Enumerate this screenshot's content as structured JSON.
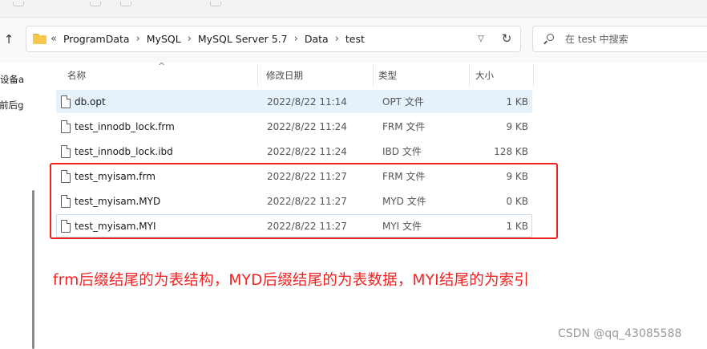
{
  "address_bar": {
    "lead": "«",
    "crumbs": [
      "ProgramData",
      "MySQL",
      "MySQL Server 5.7",
      "Data",
      "test"
    ]
  },
  "search": {
    "placeholder": "在 test 中搜索"
  },
  "sidebar": {
    "items": [
      "设备a",
      "-前后g"
    ]
  },
  "columns": {
    "name": "名称",
    "date": "修改日期",
    "type": "类型",
    "size": "大小"
  },
  "files": [
    {
      "name": "db.opt",
      "date": "2022/8/22 11:14",
      "type": "OPT 文件",
      "size": "1 KB",
      "state": "selected"
    },
    {
      "name": "test_innodb_lock.frm",
      "date": "2022/8/22 11:24",
      "type": "FRM 文件",
      "size": "9 KB",
      "state": "none"
    },
    {
      "name": "test_innodb_lock.ibd",
      "date": "2022/8/22 11:24",
      "type": "IBD 文件",
      "size": "128 KB",
      "state": "none"
    },
    {
      "name": "test_myisam.frm",
      "date": "2022/8/22 11:27",
      "type": "FRM 文件",
      "size": "9 KB",
      "state": "none"
    },
    {
      "name": "test_myisam.MYD",
      "date": "2022/8/22 11:27",
      "type": "MYD 文件",
      "size": "0 KB",
      "state": "none"
    },
    {
      "name": "test_myisam.MYI",
      "date": "2022/8/22 11:27",
      "type": "MYI 文件",
      "size": "1 KB",
      "state": "focused"
    }
  ],
  "annotation": {
    "caption": "frm后缀结尾的为表结构，MYD后缀结尾的为表数据，MYI结尾的为索引",
    "watermark": "CSDN @qq_43085588"
  },
  "colors": {
    "highlight_box": "#ee2020",
    "caption": "#f02222",
    "selection": "#e5f1fb"
  }
}
